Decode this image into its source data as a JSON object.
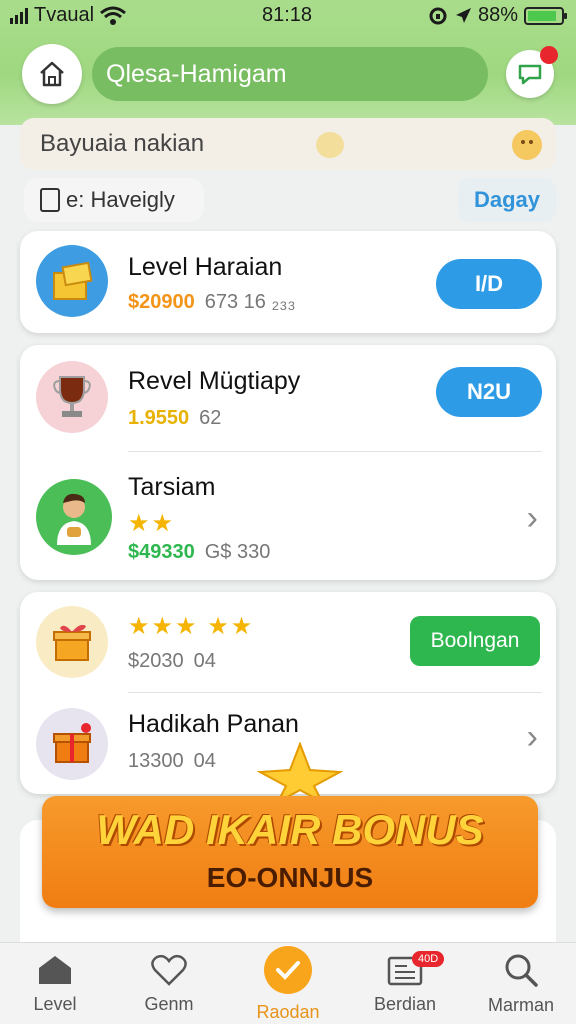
{
  "status_bar": {
    "carrier": "Tvaual",
    "time": "81:18",
    "battery": "88%",
    "battery_level": 0.88
  },
  "header": {
    "title": "Qlesa-Hamigam"
  },
  "search": {
    "placeholder": "Bayuaia nakian"
  },
  "filter": {
    "label": "e: Haveigly",
    "right_link": "Dagay"
  },
  "card1": {
    "rows": [
      {
        "name": "Level Haraian",
        "price": "$20900",
        "sub": "673 16 ₂₃₃",
        "button": "I/D"
      }
    ]
  },
  "card2": {
    "rows": [
      {
        "name": "Revel Mügtiapy",
        "price": "1.9550",
        "sub": "62",
        "button": "N2U"
      },
      {
        "name": "Tarsiam",
        "stars": "★★",
        "price": "$49330",
        "sub": "G$ 330"
      }
    ]
  },
  "card3": {
    "rows": [
      {
        "stars": "★★★ ★★",
        "price": "$2030",
        "sub": "04",
        "button": "Boolngan"
      },
      {
        "name": "Hadikah Panan",
        "price": "13300",
        "sub": "04"
      }
    ]
  },
  "banner": {
    "title": "WAD IKAIR BONUS",
    "subtitle": "EO-ONNJUS"
  },
  "tabbar": {
    "tabs": [
      {
        "label": "Level"
      },
      {
        "label": "Genm"
      },
      {
        "label": "Raodan"
      },
      {
        "label": "Berdian",
        "badge": "40D"
      },
      {
        "label": "Marman"
      }
    ]
  },
  "colors": {
    "accent": "#2e9be6",
    "green": "#2fb74f",
    "orange": "#f07d12",
    "header_green": "#78bd61"
  }
}
